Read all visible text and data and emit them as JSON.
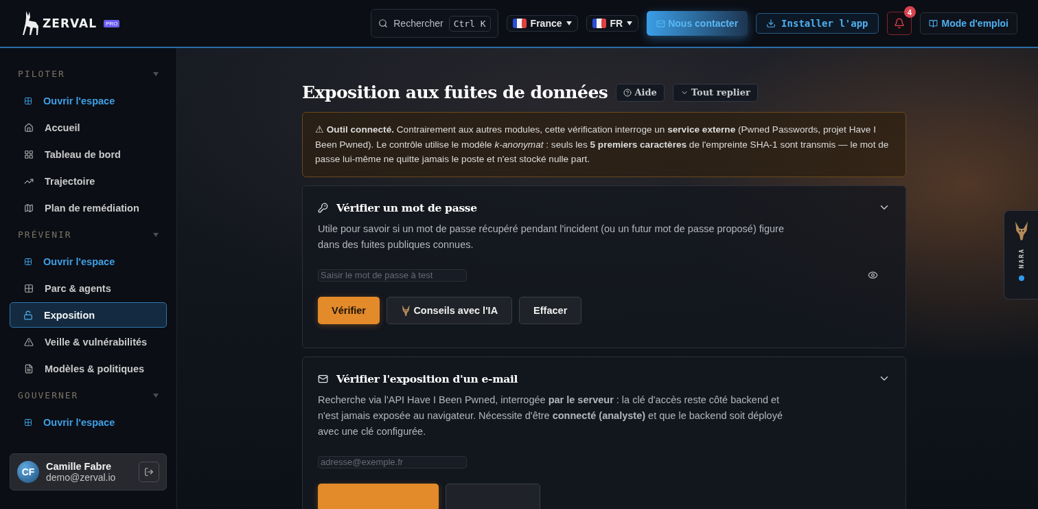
{
  "header": {
    "logo": "ZERVAL",
    "logo_badge": "PRO",
    "search": {
      "placeholder": "Rechercher",
      "shortcut": "Ctrl K"
    },
    "country": "France",
    "language": "FR",
    "contact_button": "Nous contacter",
    "install_button": "Installer l'app",
    "notifications": {
      "count": "4"
    },
    "manual_button": "Mode d'emploi"
  },
  "sidebar": {
    "sections": [
      {
        "label": "PILOTER",
        "expanded": true,
        "items": [
          {
            "label": "Ouvrir l'espace",
            "kind": "space",
            "selected": false
          },
          {
            "label": "Accueil",
            "kind": "page",
            "selected": false
          },
          {
            "label": "Tableau de bord",
            "kind": "page",
            "selected": false
          },
          {
            "label": "Trajectoire",
            "kind": "page",
            "selected": false
          },
          {
            "label": "Plan de remédiation",
            "kind": "page",
            "selected": false
          }
        ]
      },
      {
        "label": "PRÉVENIR",
        "expanded": true,
        "items": [
          {
            "label": "Ouvrir l'espace",
            "kind": "space",
            "selected": false
          },
          {
            "label": "Parc & agents",
            "kind": "page",
            "selected": false
          },
          {
            "label": "Exposition",
            "kind": "page",
            "selected": true
          },
          {
            "label": "Veille & vulnérabilités",
            "kind": "page",
            "selected": false
          },
          {
            "label": "Modèles & politiques",
            "kind": "page",
            "selected": false
          }
        ]
      },
      {
        "label": "GOUVERNER",
        "expanded": true,
        "items": [
          {
            "label": "Ouvrir l'espace",
            "kind": "space",
            "selected": false
          }
        ]
      }
    ]
  },
  "user": {
    "initials": "CF",
    "name": "Camille Fabre",
    "email": "demo@zerval.io"
  },
  "page": {
    "title": "Exposition aux fuites de données",
    "help_button": "Aide",
    "collapse_button": "Tout replier",
    "notice": "⚠ **Outil connecté.** Contrairement aux autres modules, cette vérification interroge un **service externe** (Pwned Passwords, projet Have I Been Pwned). Le contrôle utilise le modèle *k-anonymat* : seuls les **5 premiers caractères** de l'empreinte SHA-1 sont transmis — le mot de passe lui-même ne quitte jamais le poste et n'est stocké nulle part.",
    "sections": [
      {
        "kind": "password",
        "title": "Vérifier un mot de passe",
        "expanded": true,
        "description": "Utile pour savoir si un mot de passe récupéré pendant l'incident (ou un futur mot de passe proposé) figure dans des fuites publiques connues.",
        "placeholder": "Saisir le mot de passe à test",
        "buttons": [
          {
            "label": "Vérifier",
            "kind": "primary"
          },
          {
            "label": "Conseils avec l'IA",
            "kind": "ai"
          },
          {
            "label": "Effacer",
            "kind": "secondary"
          }
        ]
      },
      {
        "kind": "email",
        "title": "Vérifier l'exposition d'un e-mail",
        "expanded": true,
        "description": "Recherche via l'API Have I Been Pwned, interrogée **par le serveur** : la clé d'accès reste côté backend et n'est jamais exposée au navigateur. Nécessite d'être **connecté (analyste)** et que le backend soit déployé avec une clé configurée.",
        "placeholder": "adresse@exemple.fr",
        "buttons": [
          {
            "kind": "primary"
          },
          {
            "kind": "secondary"
          }
        ]
      }
    ]
  },
  "assistant_tab": {
    "label": "NARA",
    "online": true
  }
}
